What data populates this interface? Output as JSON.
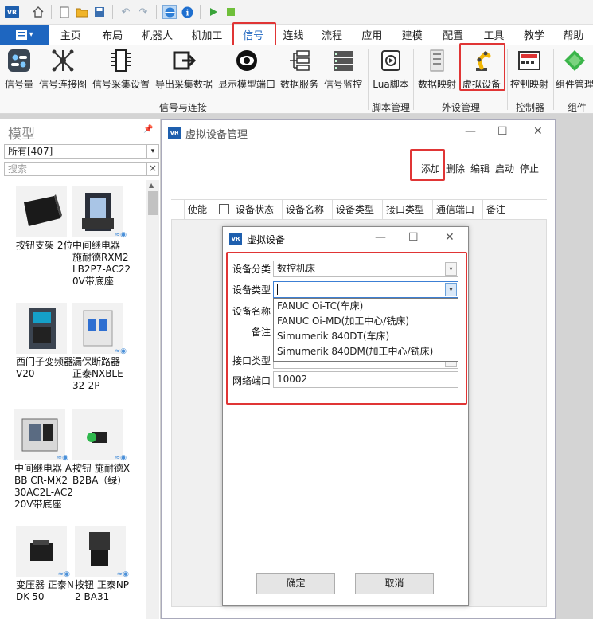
{
  "quick_access": {
    "logo": "VR",
    "icons": [
      "home-icon",
      "new-file-icon",
      "open-folder-icon",
      "save-icon",
      "undo-icon",
      "redo-icon",
      "globe-icon",
      "info-icon",
      "play-icon",
      "stop-icon"
    ]
  },
  "menu": {
    "tabs": [
      "主页",
      "布局",
      "机器人",
      "机加工",
      "信号",
      "连线",
      "流程",
      "应用",
      "建模",
      "配置",
      "工具",
      "教学",
      "帮助"
    ],
    "active": "信号"
  },
  "ribbon": {
    "buttons": [
      "信号量",
      "信号连接图",
      "信号采集设置",
      "导出采集数据",
      "显示模型端口",
      "数据服务",
      "信号监控",
      "Lua脚本",
      "数据映射",
      "虚拟设备",
      "控制映射",
      "组件管理"
    ],
    "groups": [
      "信号与连接",
      "脚本管理",
      "外设管理",
      "控制器",
      "组件"
    ]
  },
  "left_panel": {
    "title": "模型",
    "filter": "所有[407]",
    "search_placeholder": "搜索",
    "items": [
      {
        "name": "按钮支架 2位"
      },
      {
        "name": "中间继电器 施耐德RXM2LB2P7-AC220V带底座"
      },
      {
        "name": "西门子变频器V20"
      },
      {
        "name": "漏保断路器 正泰NXBLE-32-2P"
      },
      {
        "name": "中间继电器 ABB CR-MX230AC2L-AC220V带底座"
      },
      {
        "name": "按钮 施耐德XB2BA（绿）"
      },
      {
        "name": "变压器 正泰NDK-50"
      },
      {
        "name": "按钮 正泰NP2-BA31"
      }
    ]
  },
  "vdm": {
    "title": "虚拟设备管理",
    "actions": [
      "添加",
      "删除",
      "编辑",
      "启动",
      "停止"
    ],
    "columns": [
      "使能",
      "设备状态",
      "设备名称",
      "设备类型",
      "接口类型",
      "通信端口",
      "备注"
    ]
  },
  "dialog": {
    "title": "虚拟设备",
    "labels": {
      "category": "设备分类",
      "type": "设备类型",
      "name": "设备名称",
      "note": "备注",
      "interface": "接口类型",
      "port": "网络端口"
    },
    "category_value": "数控机床",
    "type_value": "",
    "port_value": "10002",
    "type_options": [
      "FANUC Oi-TC(车床)",
      "FANUC Oi-MD(加工中心/铣床)",
      "Simumerik 840DT(车床)",
      "Simumerik 840DM(加工中心/铣床)"
    ],
    "ok": "确定",
    "cancel": "取消"
  },
  "colors": {
    "accent": "#1e66c0",
    "highlight_red": "#e03535"
  }
}
